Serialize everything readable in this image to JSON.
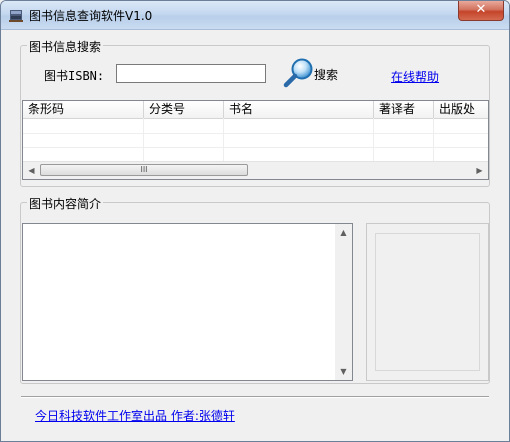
{
  "window": {
    "title": "图书信息查询软件V1.0",
    "close_label": "✕"
  },
  "search_group": {
    "legend": "图书信息搜索",
    "isbn_label": "图书ISBN:",
    "isbn_value": "",
    "search_label": "搜索",
    "help_link": "在线帮助"
  },
  "grid": {
    "columns": [
      "条形码",
      "分类号",
      "书名",
      "著译者",
      "出版处"
    ],
    "scroll_thumb_label": "III"
  },
  "content_group": {
    "legend": "图书内容简介",
    "text": ""
  },
  "footer": {
    "credit": "今日科技软件工作室出品  作者:张德轩"
  }
}
